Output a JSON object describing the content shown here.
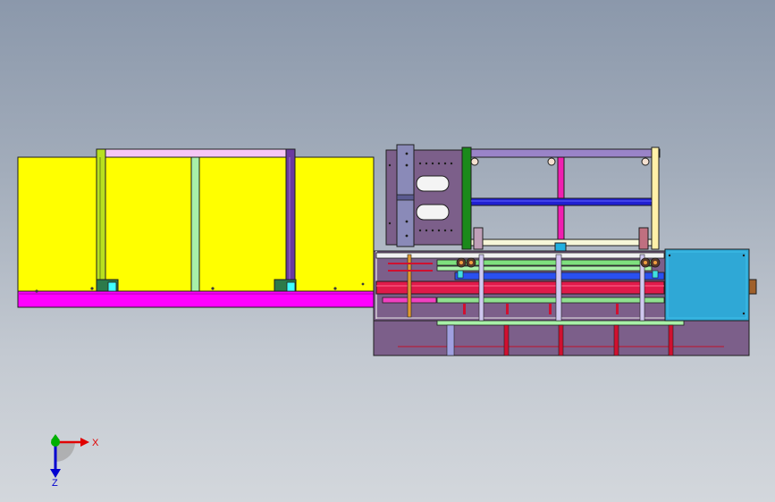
{
  "viewport": {
    "background_top": "#8b98ab",
    "background_bottom": "#d3d7dc"
  },
  "colors": {
    "left_panel": "#ffff00",
    "base_plate": "#ff00ff",
    "main_body": "#7c5f8a",
    "cabinet": "#2fa8d6",
    "outline": "#1e1e1e",
    "x_axis": "#e00000",
    "y_axis": "#00b000",
    "z_axis": "#0000d0"
  },
  "triad": {
    "x_label": "X",
    "z_label": "Z",
    "x_icon": "x-axis-arrow-icon",
    "y_icon": "y-axis-arrow-icon",
    "z_icon": "z-axis-arrow-icon"
  }
}
